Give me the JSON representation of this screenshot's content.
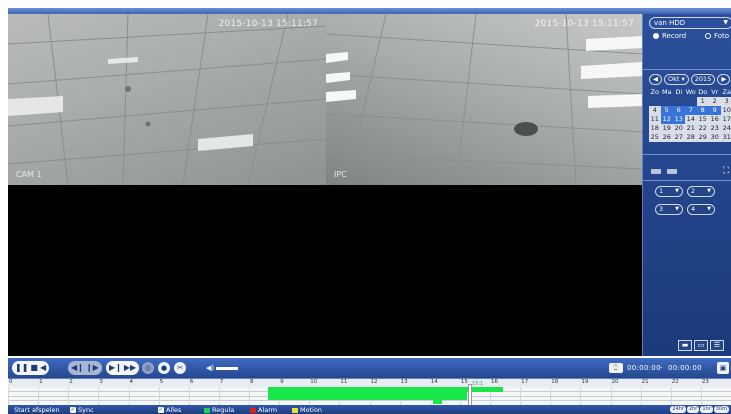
{
  "video": {
    "tiles": [
      {
        "timestamp": "2015-10-13 15:11:57",
        "label": "CAM 1"
      },
      {
        "timestamp": "2015-10-13 15:11:57",
        "label": "IPC"
      }
    ]
  },
  "panel": {
    "source_select": "van HDD",
    "radio_record": "Record",
    "radio_foto": "Foto",
    "month_select": "Okt",
    "year_select": "2015",
    "weekdays": [
      "Zo",
      "Ma",
      "Di",
      "Wo",
      "Do",
      "Vr",
      "Za"
    ],
    "calendar_rows": [
      [
        "",
        "",
        "",
        "",
        "1",
        "2",
        "3"
      ],
      [
        "4",
        "5",
        "6",
        "7",
        "8",
        "9",
        "10"
      ],
      [
        "11",
        "12",
        "13",
        "14",
        "15",
        "16",
        "17"
      ],
      [
        "18",
        "19",
        "20",
        "21",
        "22",
        "23",
        "24"
      ],
      [
        "25",
        "26",
        "27",
        "28",
        "29",
        "30",
        "31"
      ]
    ],
    "recorded_days": [
      "5",
      "6",
      "7",
      "8",
      "9",
      "12",
      "13"
    ],
    "channels": [
      "1",
      "2",
      "3",
      "4"
    ]
  },
  "controls": {
    "time_start": "00:00:00",
    "time_separator": "-",
    "time_end": "00:00:00"
  },
  "timeline": {
    "hours": [
      "0",
      "1",
      "2",
      "3",
      "4",
      "5",
      "6",
      "7",
      "8",
      "9",
      "10",
      "11",
      "12",
      "13",
      "14",
      "15",
      "16",
      "17",
      "18",
      "19",
      "20",
      "21",
      "22",
      "23"
    ],
    "cursor_label": "15:1"
  },
  "bottom": {
    "start_label": "Start afspelen",
    "sync_label": "Sync",
    "alles_label": "Alles",
    "regula_label": "Regula",
    "alarm_label": "Alarm",
    "motion_label": "Motion",
    "zoom_options": [
      "24hr",
      "2hr",
      "1hr",
      "30m"
    ],
    "colors": {
      "regula": "#1fd04a",
      "alarm": "#e0241b",
      "motion": "#e7e12a"
    }
  }
}
